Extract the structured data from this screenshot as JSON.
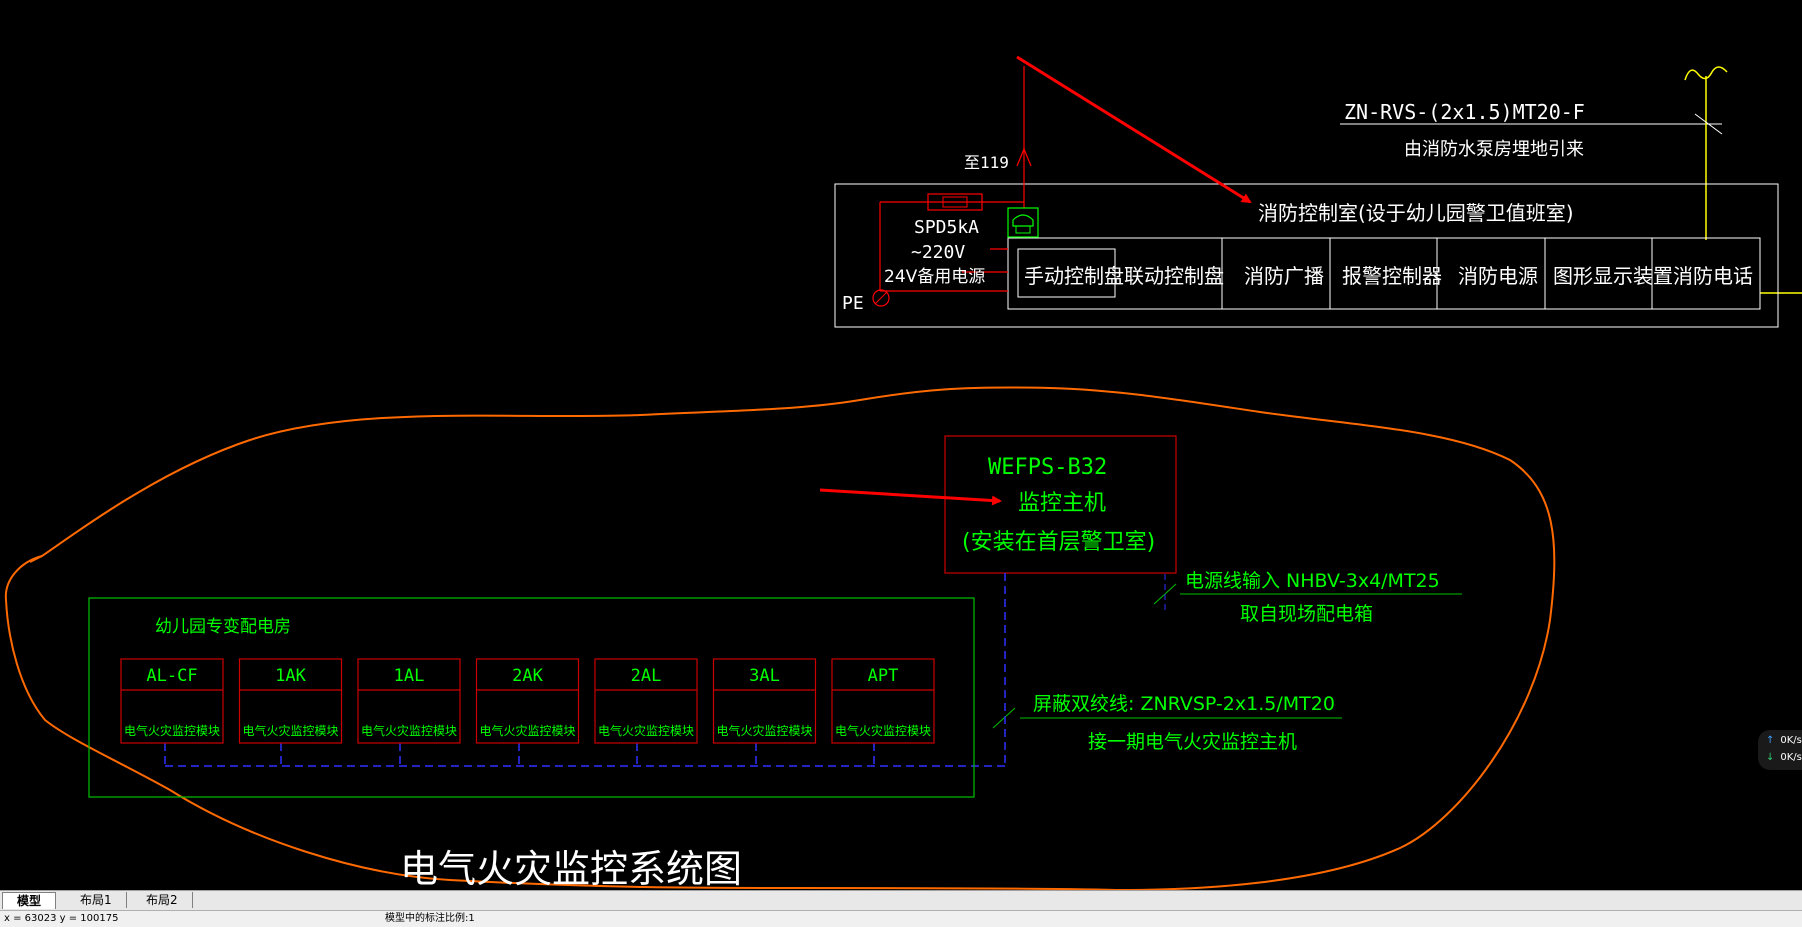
{
  "drawing": {
    "cable_top": "ZN-RVS-(2x1.5)MT20-F",
    "cable_top_note": "由消防水泵房埋地引来",
    "to_119": "至119",
    "spd": "SPD5kA",
    "ac220": "~220V",
    "backup_24v": "24V备用电源",
    "pe": "PE",
    "control_room": "消防控制室(设于幼儿园警卫值班室)",
    "panels": [
      "手动控制盘",
      "联动控制盘",
      "消防广播",
      "报警控制器",
      "消防电源",
      "图形显示装置",
      "消防电话"
    ],
    "host_model": "WEFPS-B32",
    "host_name": "监控主机",
    "host_location": "(安装在首层警卫室)",
    "power_input": "电源线输入 NHBV-3x4/MT25",
    "power_from": "取自现场配电箱",
    "kg_room": "幼儿园专变配电房",
    "modules": [
      {
        "name": "AL-CF",
        "label": "电气火灾监控模块"
      },
      {
        "name": "1AK",
        "label": "电气火灾监控模块"
      },
      {
        "name": "1AL",
        "label": "电气火灾监控模块"
      },
      {
        "name": "2AK",
        "label": "电气火灾监控模块"
      },
      {
        "name": "2AL",
        "label": "电气火灾监控模块"
      },
      {
        "name": "3AL",
        "label": "电气火灾监控模块"
      },
      {
        "name": "APT",
        "label": "电气火灾监控模块"
      }
    ],
    "shield_cable": "屏蔽双绞线: ZNRVSP-2x1.5/MT20",
    "shield_cable_note": "接一期电气火灾监控主机",
    "title": "电气火灾监控系统图"
  },
  "colors": {
    "background": "#000000",
    "white_line": "#ffffff",
    "red": "#ff0000",
    "dark_red": "#cc0000",
    "green": "#00ff00",
    "dark_green": "#00c000",
    "yellow": "#ffff00",
    "blue_dash": "#3030ff",
    "orange_markup": "#ff6a00"
  },
  "tabs": [
    "模型",
    "布局1",
    "布局2"
  ],
  "status": {
    "coords": "x = 63023  y = 100175",
    "scale": "模型中的标注比例:1"
  },
  "net_widget": {
    "up": "0K/s",
    "down": "0K/s",
    "up_icon": "arrow-up-icon",
    "down_icon": "arrow-down-icon"
  }
}
